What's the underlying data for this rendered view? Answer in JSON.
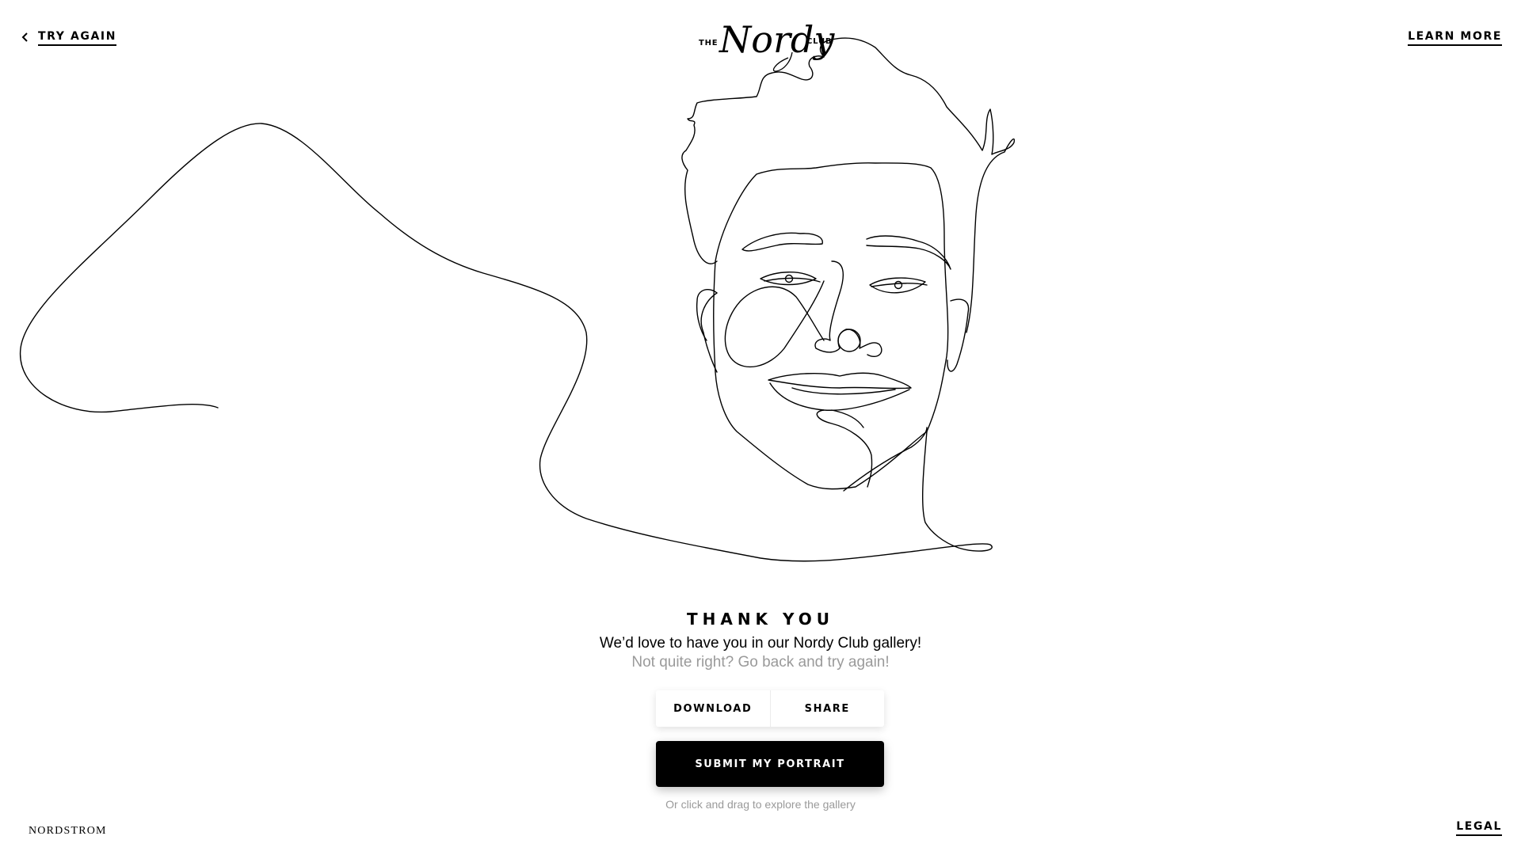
{
  "header": {
    "try_again": "TRY AGAIN",
    "learn_more": "LEARN MORE",
    "logo": {
      "prefix": "THE",
      "script": "Nordy",
      "suffix": "CLUB"
    }
  },
  "main": {
    "headline": "THANK YOU",
    "subline": "We’d love to have you in our Nordy Club gallery!",
    "subline_secondary": "Not quite right? Go back and try again!",
    "download_label": "DOWNLOAD",
    "share_label": "SHARE",
    "submit_label": "SUBMIT MY PORTRAIT",
    "hint": "Or click and drag to explore the gallery"
  },
  "footer": {
    "brand": "NORDSTROM",
    "legal": "LEGAL"
  },
  "icons": {
    "back": "chevron-left-icon",
    "portrait": "line-drawing-portrait"
  },
  "colors": {
    "primary": "#000000",
    "background": "#ffffff",
    "muted_text": "#9a9a9a"
  }
}
